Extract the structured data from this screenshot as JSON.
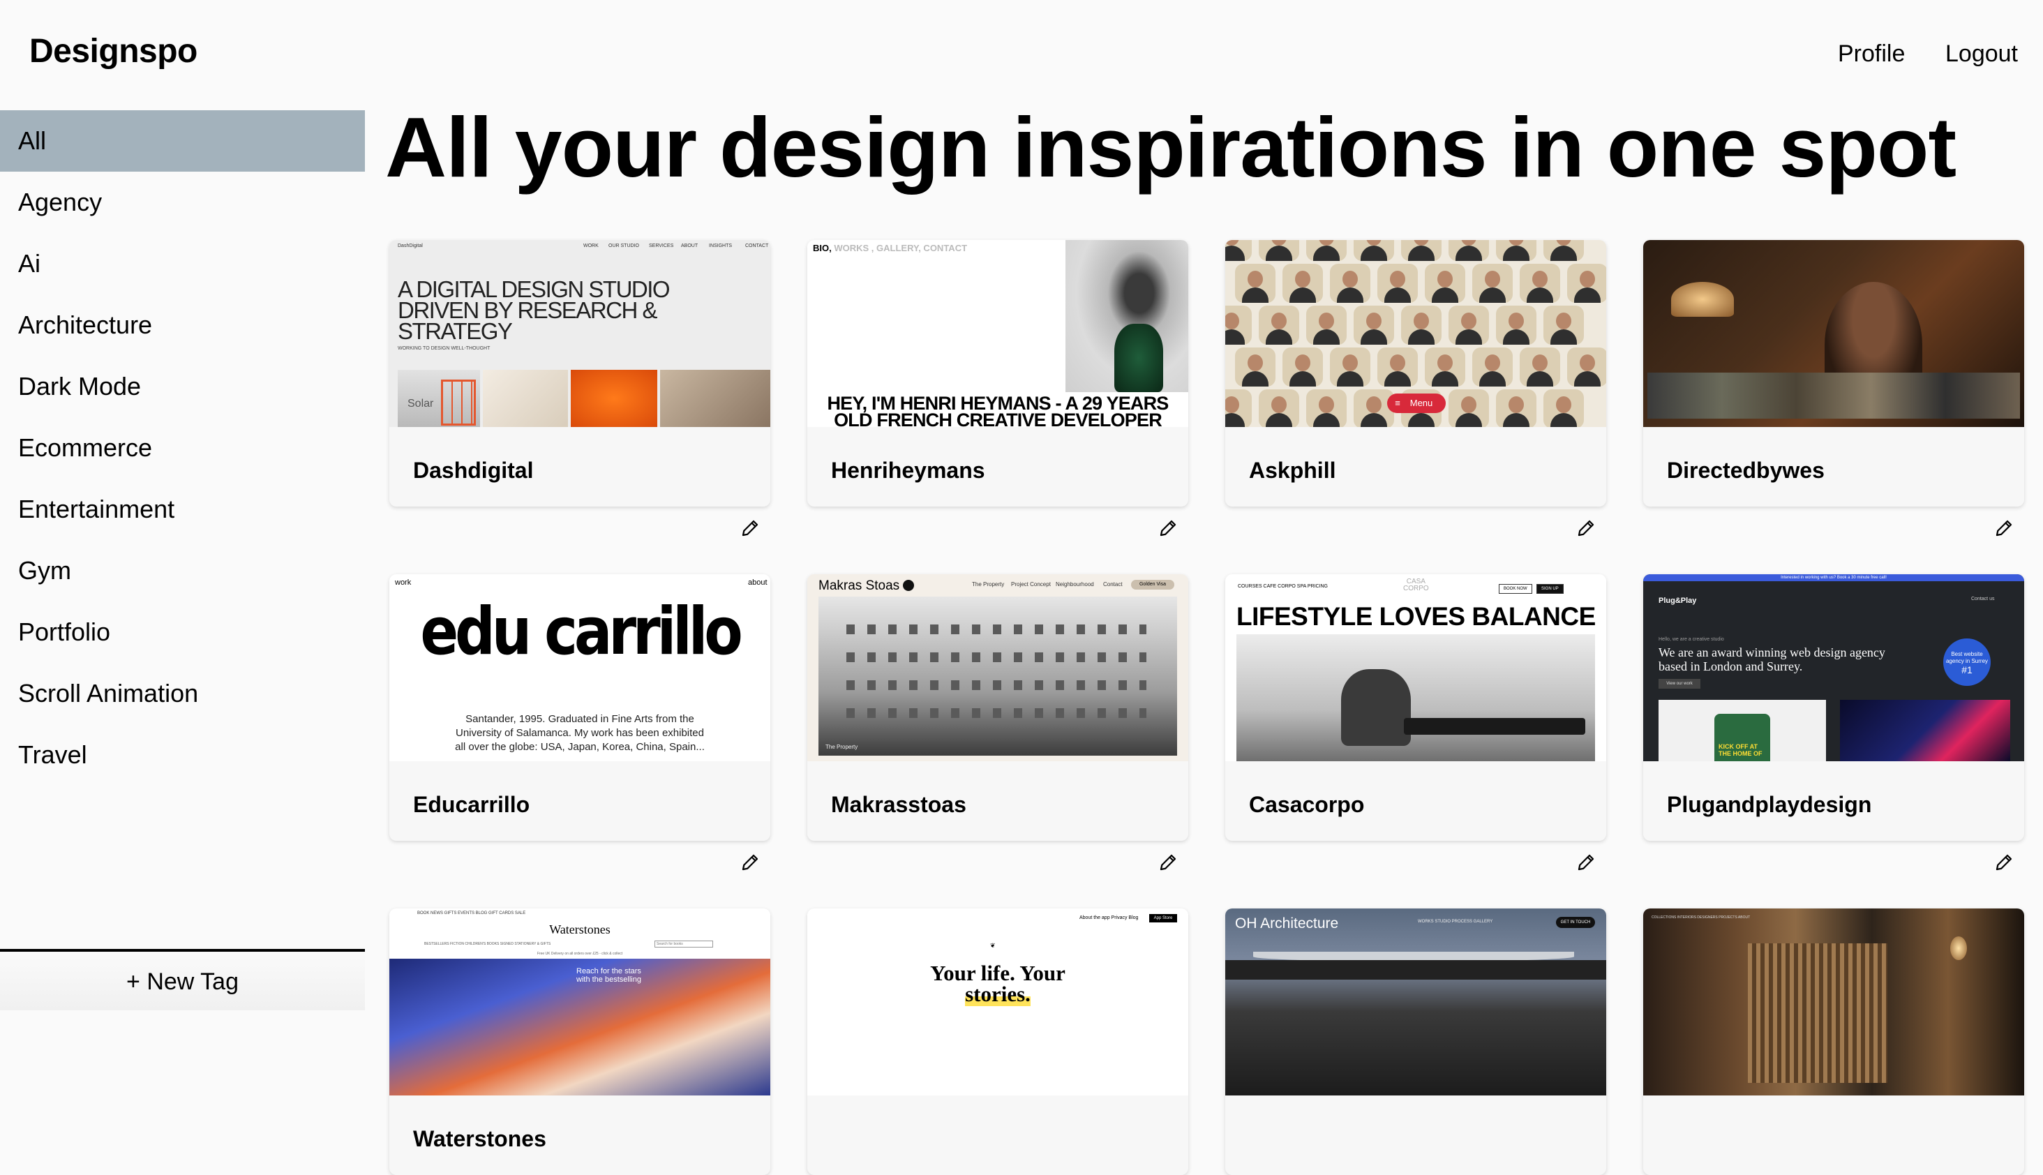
{
  "app": {
    "logo": "Designspo"
  },
  "header": {
    "profile_label": "Profile",
    "logout_label": "Logout"
  },
  "sidebar": {
    "active_index": 0,
    "active_color": "#a3b2bc",
    "items": [
      {
        "label": "All"
      },
      {
        "label": "Agency"
      },
      {
        "label": "Ai"
      },
      {
        "label": "Architecture"
      },
      {
        "label": "Dark Mode"
      },
      {
        "label": "Ecommerce"
      },
      {
        "label": "Entertainment"
      },
      {
        "label": "Gym"
      },
      {
        "label": "Portfolio"
      },
      {
        "label": "Scroll Animation"
      },
      {
        "label": "Travel"
      }
    ],
    "new_tag_label": "+ New Tag"
  },
  "main": {
    "title": "All your design inspirations in one spot",
    "cards": [
      {
        "title": "Dashdigital",
        "thumb": {
          "brand": "DashDigital",
          "nav": [
            "WORK",
            "OUR STUDIO",
            "SERVICES",
            "ABOUT",
            "INSIGHTS",
            "CONTACT"
          ],
          "headline": [
            "A DIGITAL DESIGN STUDIO",
            "DRIVEN BY RESEARCH &",
            "STRATEGY"
          ],
          "sub": "WORKING TO DESIGN WELL-THOUGHT",
          "tag": "Solar"
        }
      },
      {
        "title": "Henriheymans",
        "thumb": {
          "nav_bold": "BIO,",
          "nav_grey": "WORKS , GALLERY, CONTACT",
          "headline": [
            "HEY, I'M HENRI HEYMANS - A 29 YEARS",
            "OLD FRENCH CREATIVE DEVELOPER"
          ]
        }
      },
      {
        "title": "Askphill",
        "thumb": {
          "menu_label": "Menu"
        }
      },
      {
        "title": "Directedbywes",
        "thumb": {}
      },
      {
        "title": "Educarrillo",
        "thumb": {
          "left": "work",
          "right": "about",
          "headline": "edu carrillo",
          "para": [
            "Santander, 1995. Graduated in Fine Arts from the",
            "University of Salamanca. My work has been exhibited",
            "all over the globe: USA, Japan, Korea, China, Spain..."
          ]
        }
      },
      {
        "title": "Makrasstoas",
        "thumb": {
          "brand": "Makras Stoas",
          "nav": [
            "The Property",
            "Project Concept",
            "Neighbourhood",
            "Contact"
          ],
          "cta": "Golden Visa",
          "caption": "The Property"
        }
      },
      {
        "title": "Casacorpo",
        "thumb": {
          "nav": "COURSES   CAFE CORPO   SPA   PRICING",
          "logo_top": "CASA",
          "logo_bottom": "CORPO",
          "book": "BOOK NOW",
          "signup": "SIGN UP",
          "headline": "LIFESTYLE LOVES BALANCE"
        }
      },
      {
        "title": "Plugandplaydesign",
        "thumb": {
          "bar": "Interested in working with us? Book a 30 minute free call!",
          "brand": "Plug&Play",
          "contact": "Contact us",
          "small": "Hello, we are a creative studio",
          "copy": "We are an award winning web design agency based in London and Surrey.",
          "view": "View our work",
          "badge": "Best website agency in Surrey",
          "badge_num": "#1",
          "kick": [
            "KICK OFF AT",
            "THE HOME OF"
          ]
        }
      },
      {
        "title": "Waterstones",
        "thumb": {
          "brand": "Waterstones",
          "nav": "BOOK NEWS   GIFTS   EVENTS   BLOG   GIFT CARDS   SALE",
          "sub": "BESTSELLERS   FICTION   CHILDREN'S BOOKS   SIGNED   STATIONERY & GIFTS",
          "search": "Search for books",
          "note": "Free UK Delivery on all orders over £25 - click & collect",
          "hero": [
            "Reach for the stars",
            "with the bestselling"
          ]
        }
      },
      {
        "title": "",
        "thumb": {
          "nav": "About the app   Privacy   Blog",
          "app": "App Store",
          "headline_1": "Your life. Your",
          "headline_2": "stories."
        }
      },
      {
        "title": "",
        "thumb": {
          "brand": "OH Architecture",
          "nav": "WORKS   STUDIO   PROCESS   GALLERY",
          "cta": "GET IN TOUCH"
        }
      },
      {
        "title": "",
        "thumb": {
          "nav": "COLLECTIONS   INTERIORS   DESIGNERS   PROJECTS   ABOUT"
        }
      }
    ]
  }
}
